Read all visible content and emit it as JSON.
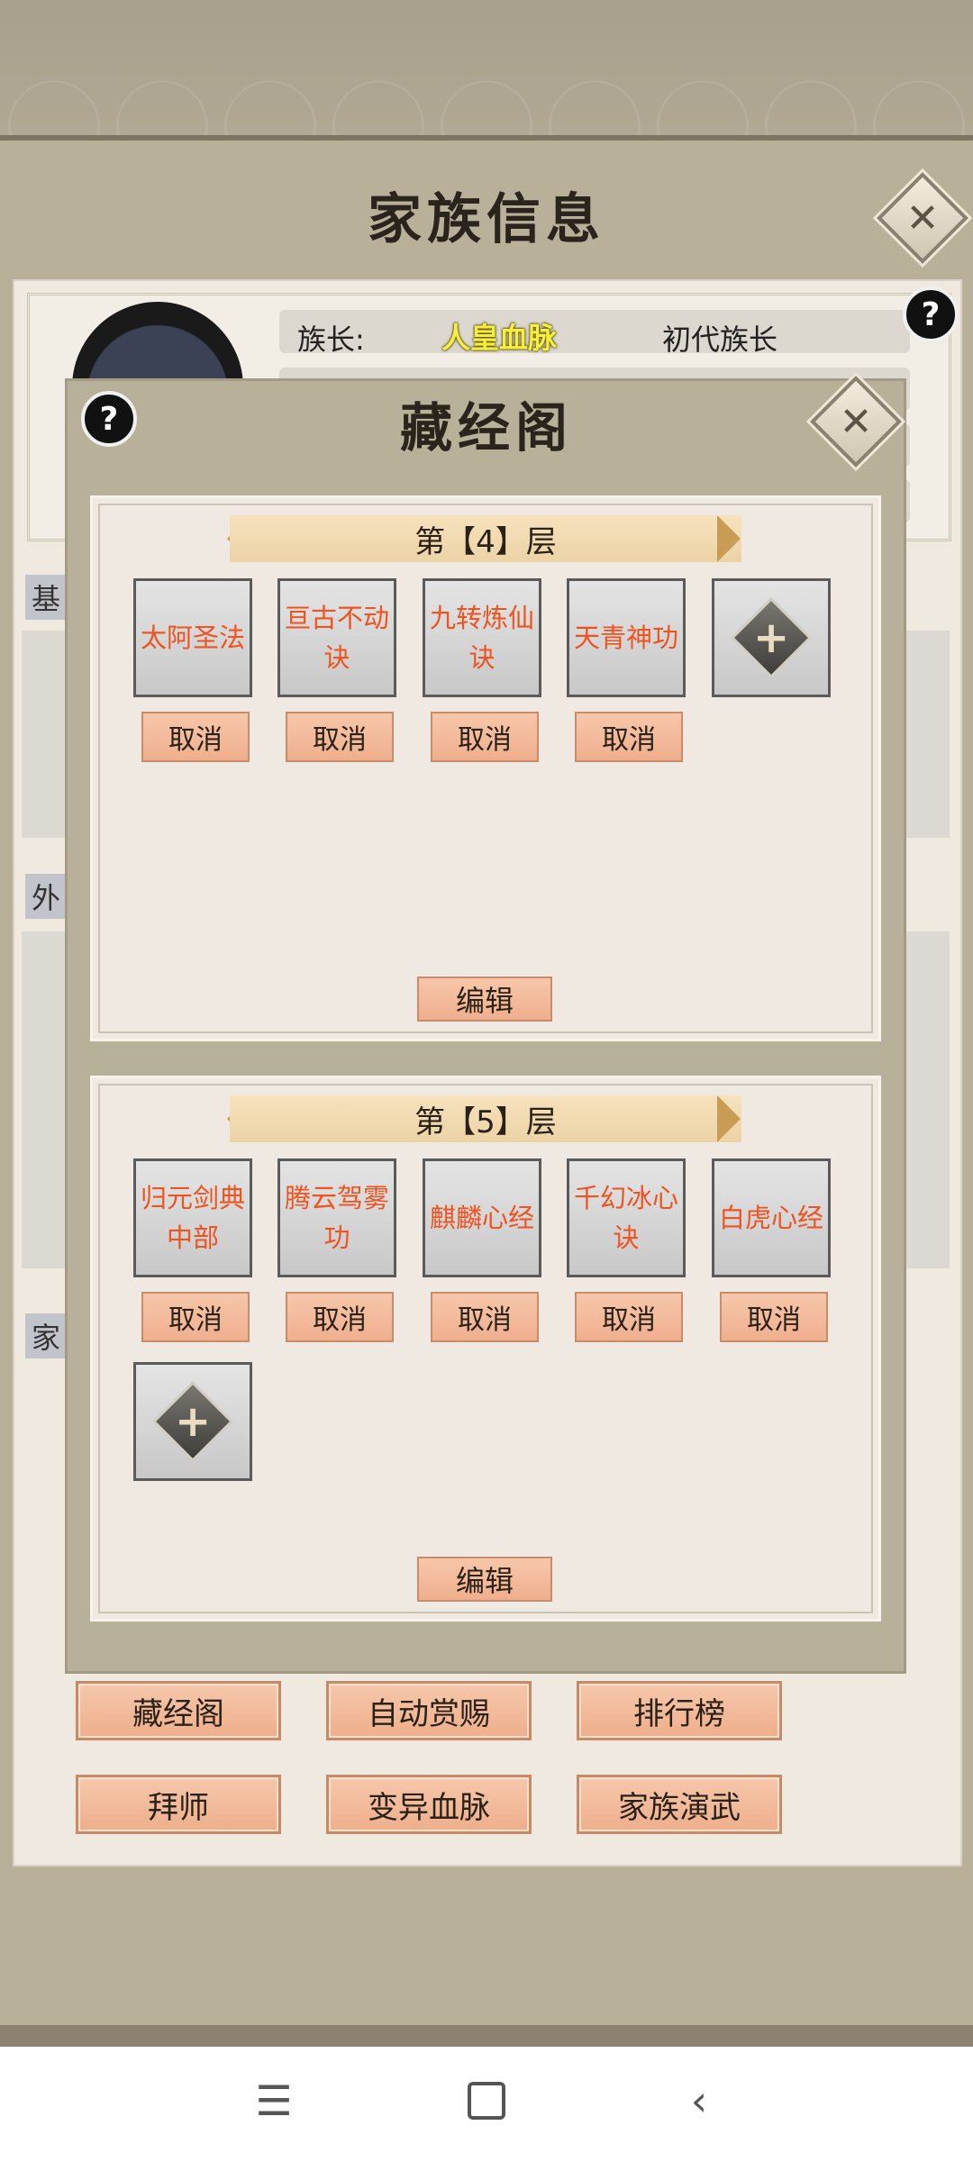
{
  "header": {
    "title": "家族信息",
    "close_icon": "close-icon"
  },
  "family": {
    "leader_label": "族长:",
    "leader_name": "人皇血脉",
    "leader_title": "初代族长",
    "section_tags": [
      "基",
      "外",
      "家"
    ]
  },
  "modal": {
    "title": "藏经阁",
    "floors": [
      {
        "label": "第【4】层",
        "techniques": [
          "太阿圣法",
          "亘古不动诀",
          "九转炼仙诀",
          "天青神功"
        ],
        "cancel_label": "取消",
        "edit_label": "编辑"
      },
      {
        "label": "第【5】层",
        "techniques": [
          "归元剑典中部",
          "腾云驾雾功",
          "麒麟心经",
          "千幻冰心诀",
          "白虎心经"
        ],
        "cancel_label": "取消",
        "edit_label": "编辑"
      }
    ]
  },
  "bottom_buttons": [
    "藏经阁",
    "自动赏赐",
    "排行榜",
    "拜师",
    "变异血脉",
    "家族演武"
  ],
  "colors": {
    "technique_text": "#ef5320",
    "leader_name": "#f7ef3a",
    "button_fill": "#f2b99a"
  }
}
